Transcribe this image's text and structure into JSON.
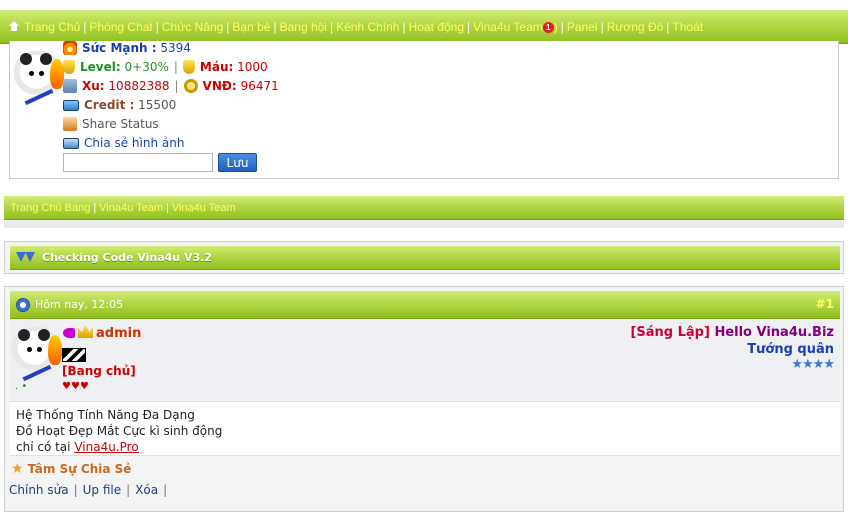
{
  "colors": {
    "accent_green": "#b7d94a",
    "nav_link_yellow": "#ffff66",
    "save_button": "#2f6fd0",
    "username_orange": "#cc3300",
    "rank_red": "#cc0033"
  },
  "top_nav": {
    "items": [
      "Trang Chủ",
      "Phòng Chat",
      "Chức Năng",
      "Bạn bè",
      "Bang hội",
      "Kênh Chính",
      "Hoạt động",
      "Vina4u Team",
      "Panel",
      "Rương Đồ",
      "Thoát"
    ],
    "team_badge": "1",
    "team_badge_close": ")"
  },
  "profile": {
    "strength_label": "Sức Mạnh :",
    "strength_value": "5394",
    "level_label": "Level:",
    "level_value": "0+30%",
    "hp_label": "Máu:",
    "hp_value": "1000",
    "xu_label": "Xu:",
    "xu_value": "10882388",
    "vnd_label": "VNĐ:",
    "vnd_value": "96471",
    "credit_label": "Credit :",
    "credit_value": "15500",
    "share_status": "Share Status",
    "share_image": "Chia sẻ hình ảnh",
    "status_input_value": "",
    "save_label": "Lưu"
  },
  "bang_nav": {
    "items": [
      "Trang Chủ Bang",
      "Vina4u Team",
      "Vina4u Team"
    ]
  },
  "checking": {
    "title": "Checking Code Vina4u V3.2"
  },
  "post": {
    "time": "Hôm nay, 12:05",
    "number": "#1",
    "username": "admin",
    "role_badge": "[Bang chủ]",
    "hearts": "♥♥♥",
    "online_dots": ". •",
    "rank_tag": "[Sáng Lập]",
    "rank_hello": "Hello Vina4u.Biz",
    "rank_title": "Tướng quân",
    "stars": "★★★★",
    "body_lines": [
      "Hệ Thống Tính Năng Đa Dạng",
      "Đồ Hoạt Đẹp Mắt Cực kì sinh động"
    ],
    "body_last_prefix": "chỉ có tại",
    "body_last_link": "Vina4u.Pro",
    "signature": "Tâm Sự Chia Sẻ",
    "actions": [
      "Chỉnh sửa",
      "Up file",
      "Xóa"
    ]
  }
}
